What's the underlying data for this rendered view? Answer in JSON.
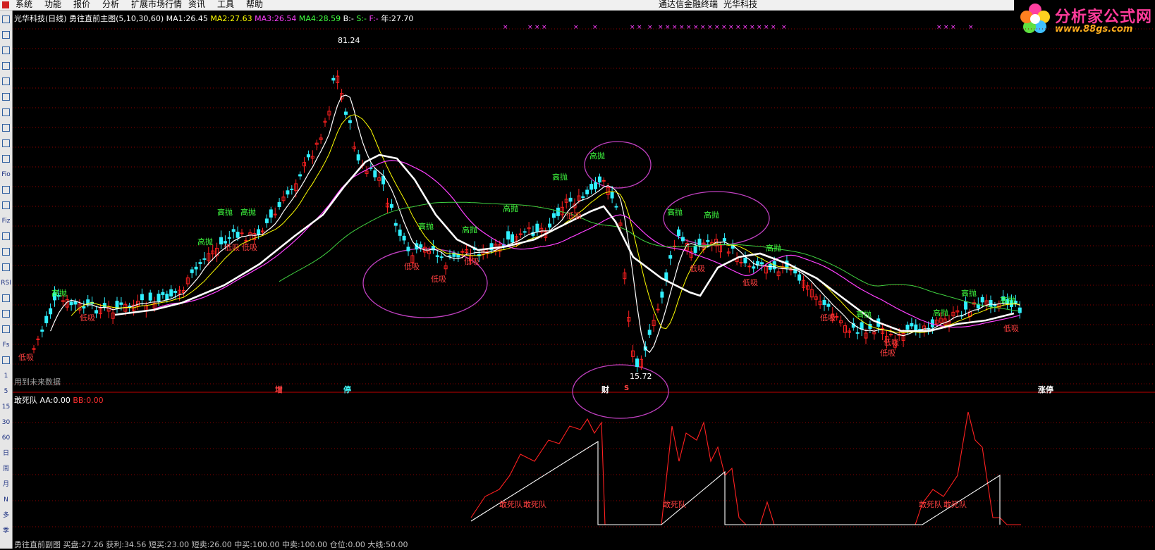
{
  "menu": {
    "items": [
      "系统",
      "功能",
      "报价",
      "分析",
      "扩展市场行情",
      "资讯",
      "工具",
      "帮助"
    ],
    "center_title": "通达信金融终端",
    "center_stock": "光华科技"
  },
  "logo": {
    "title": "分析家公式网",
    "url_text": "www.88gs.com"
  },
  "toolbar": {
    "items": [
      "icon",
      "icon",
      "icon",
      "icon",
      "icon",
      "icon",
      "icon",
      "icon",
      "icon",
      "icon",
      "Fio",
      "icon",
      "icon",
      "Fiz",
      "icon",
      "icon",
      "icon",
      "RSI",
      "icon",
      "icon",
      "icon",
      "Fs",
      "icon",
      "1",
      "5",
      "15",
      "30",
      "60",
      "日",
      "周",
      "月",
      "N",
      "多",
      "季"
    ]
  },
  "main_info": {
    "stock": "光华科技(日线)",
    "indicator": "勇往直前主图(5,10,30,60)",
    "ma1": {
      "label": "MA1:",
      "value": "26.45",
      "color": "#ffffff"
    },
    "ma2": {
      "label": "MA2:",
      "value": "27.63",
      "color": "#ffff00"
    },
    "ma3": {
      "label": "MA3:",
      "value": "26.54",
      "color": "#ff40ff"
    },
    "ma4": {
      "label": "MA4:",
      "value": "28.59",
      "color": "#40ff40"
    },
    "b": {
      "label": "B:",
      "value": "-",
      "color": "#ffffff"
    },
    "s": {
      "label": "S:",
      "value": "-",
      "color": "#40ff40"
    },
    "f": {
      "label": "F:",
      "value": "-",
      "color": "#ff40ff"
    },
    "year": {
      "label": "年:",
      "value": "27.70",
      "color": "#ffffff"
    }
  },
  "future_data_text": "用到未来数据",
  "sub_info": {
    "name": "敢死队",
    "aa": {
      "label": "AA:",
      "value": "0.00",
      "color": "#ffffff"
    },
    "bb": {
      "label": "BB:",
      "value": "0.00",
      "color": "#ff3030"
    }
  },
  "bottom_info": "勇往直前副图  买盘:27.26  获利:34.56  短买:23.00  短卖:26.00  中买:100.00  中卖:100.00  仓位:0.00  大线:50.00",
  "price_labels": {
    "high": "81.24",
    "low": "15.72"
  },
  "axis_markers": [
    {
      "text": "增",
      "color": "#ff4040"
    },
    {
      "text": "停",
      "color": "#40ffff"
    },
    {
      "text": "财",
      "color": "#ffffff"
    },
    {
      "text": "S",
      "color": "#ff4040"
    },
    {
      "text": "涨停",
      "color": "#ffffff"
    }
  ],
  "signals": {
    "sell": "高抛",
    "buy": "低吸",
    "team": "敢死队"
  },
  "colors": {
    "up": "#ff2020",
    "down": "#30f0ff",
    "ma5": "#ffffff",
    "ma10": "#ffff00",
    "ma30": "#ff40ff",
    "ma60": "#40d040",
    "grid": "#8b0000",
    "ellipse": "#c040c0"
  },
  "chart_data": {
    "type": "candlestick",
    "title": "光华科技(日线)",
    "high": 81.24,
    "low": 15.72,
    "ma_names": [
      "MA1",
      "MA2",
      "MA3",
      "MA4"
    ],
    "ma_last": [
      26.45,
      27.63,
      26.54,
      28.59
    ]
  }
}
